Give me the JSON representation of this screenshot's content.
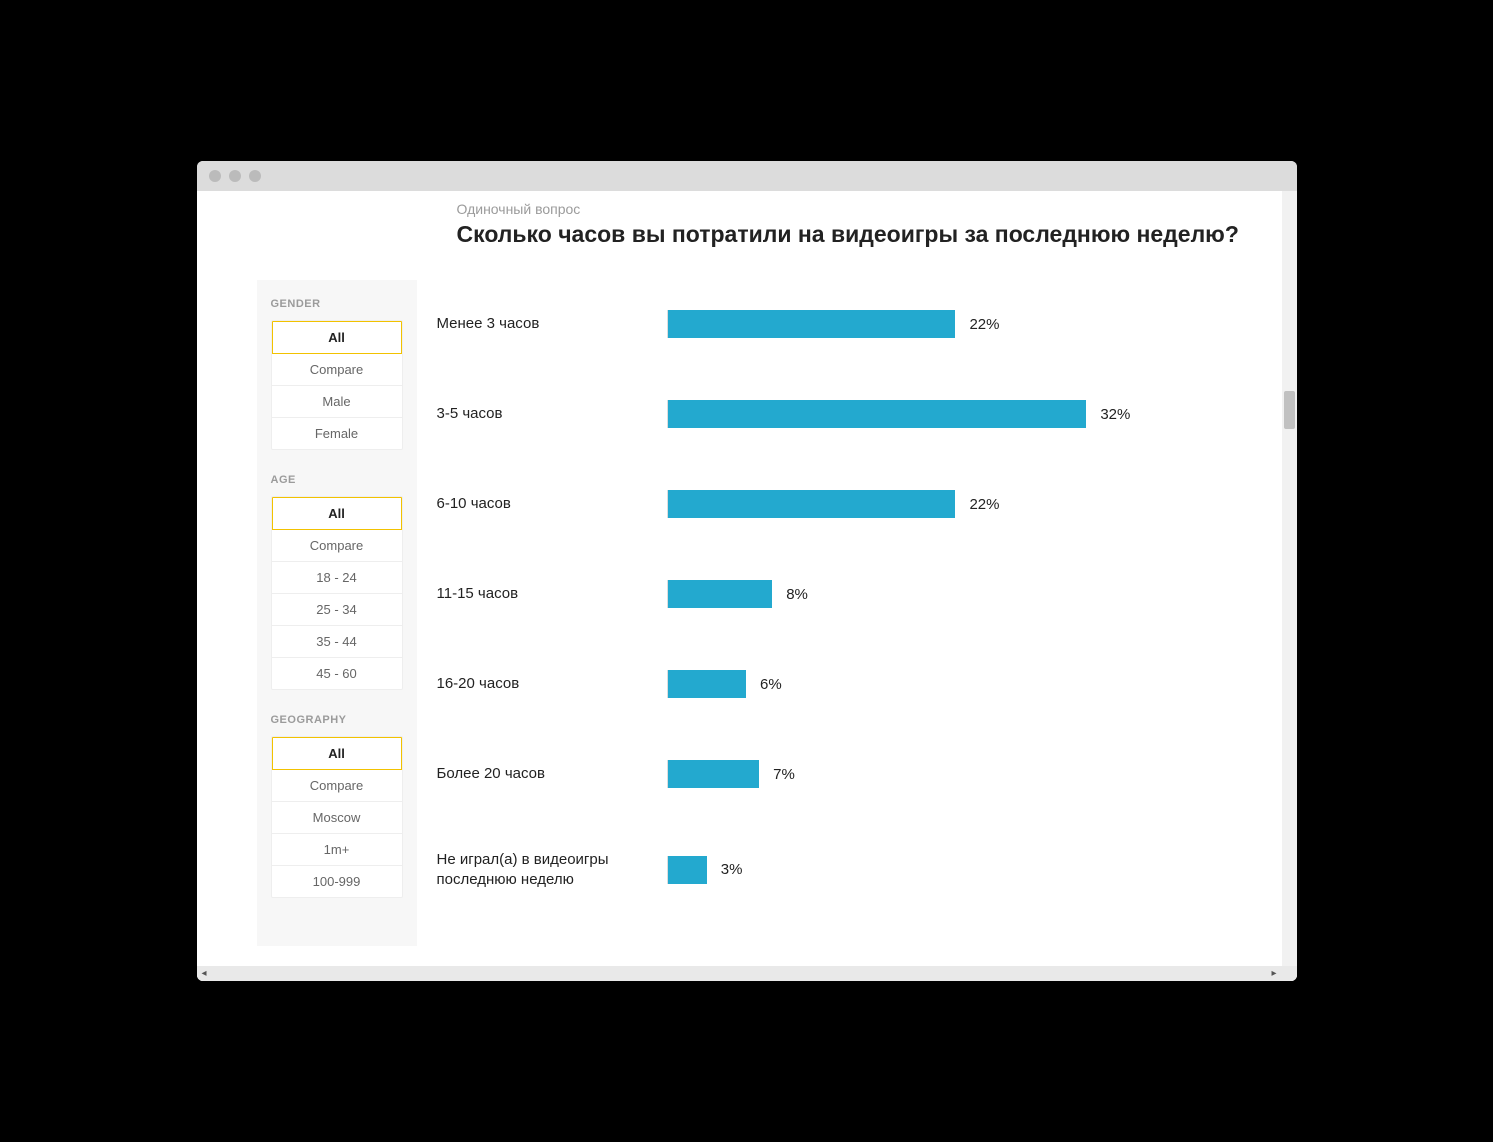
{
  "question_type": "Одиночный вопрос",
  "question_title": "Сколько часов вы потратили на видеоигры за последнюю неделю?",
  "sidebar": {
    "groups": [
      {
        "label": "GENDER",
        "items": [
          {
            "label": "All",
            "selected": true
          },
          {
            "label": "Compare",
            "selected": false
          },
          {
            "label": "Male",
            "selected": false
          },
          {
            "label": "Female",
            "selected": false
          }
        ]
      },
      {
        "label": "AGE",
        "items": [
          {
            "label": "All",
            "selected": true
          },
          {
            "label": "Compare",
            "selected": false
          },
          {
            "label": "18 - 24",
            "selected": false
          },
          {
            "label": "25 - 34",
            "selected": false
          },
          {
            "label": "35 - 44",
            "selected": false
          },
          {
            "label": "45 - 60",
            "selected": false
          }
        ]
      },
      {
        "label": "GEOGRAPHY",
        "items": [
          {
            "label": "All",
            "selected": true
          },
          {
            "label": "Compare",
            "selected": false
          },
          {
            "label": "Moscow",
            "selected": false
          },
          {
            "label": "1m+",
            "selected": false
          },
          {
            "label": "100-999",
            "selected": false
          }
        ]
      }
    ]
  },
  "chart_data": {
    "type": "bar",
    "title": "Сколько часов вы потратили на видеоигры за последнюю неделю?",
    "xlabel": "",
    "ylabel": "",
    "ylim": [
      0,
      100
    ],
    "categories": [
      "Менее 3 часов",
      "3-5 часов",
      "6-10 часов",
      "11-15 часов",
      "16-20 часов",
      "Более 20 часов",
      "Не играл(а) в видеоигры последнюю неделю"
    ],
    "values": [
      22,
      32,
      22,
      8,
      6,
      7,
      3
    ],
    "value_suffix": "%",
    "bar_color": "#23a9cf"
  }
}
